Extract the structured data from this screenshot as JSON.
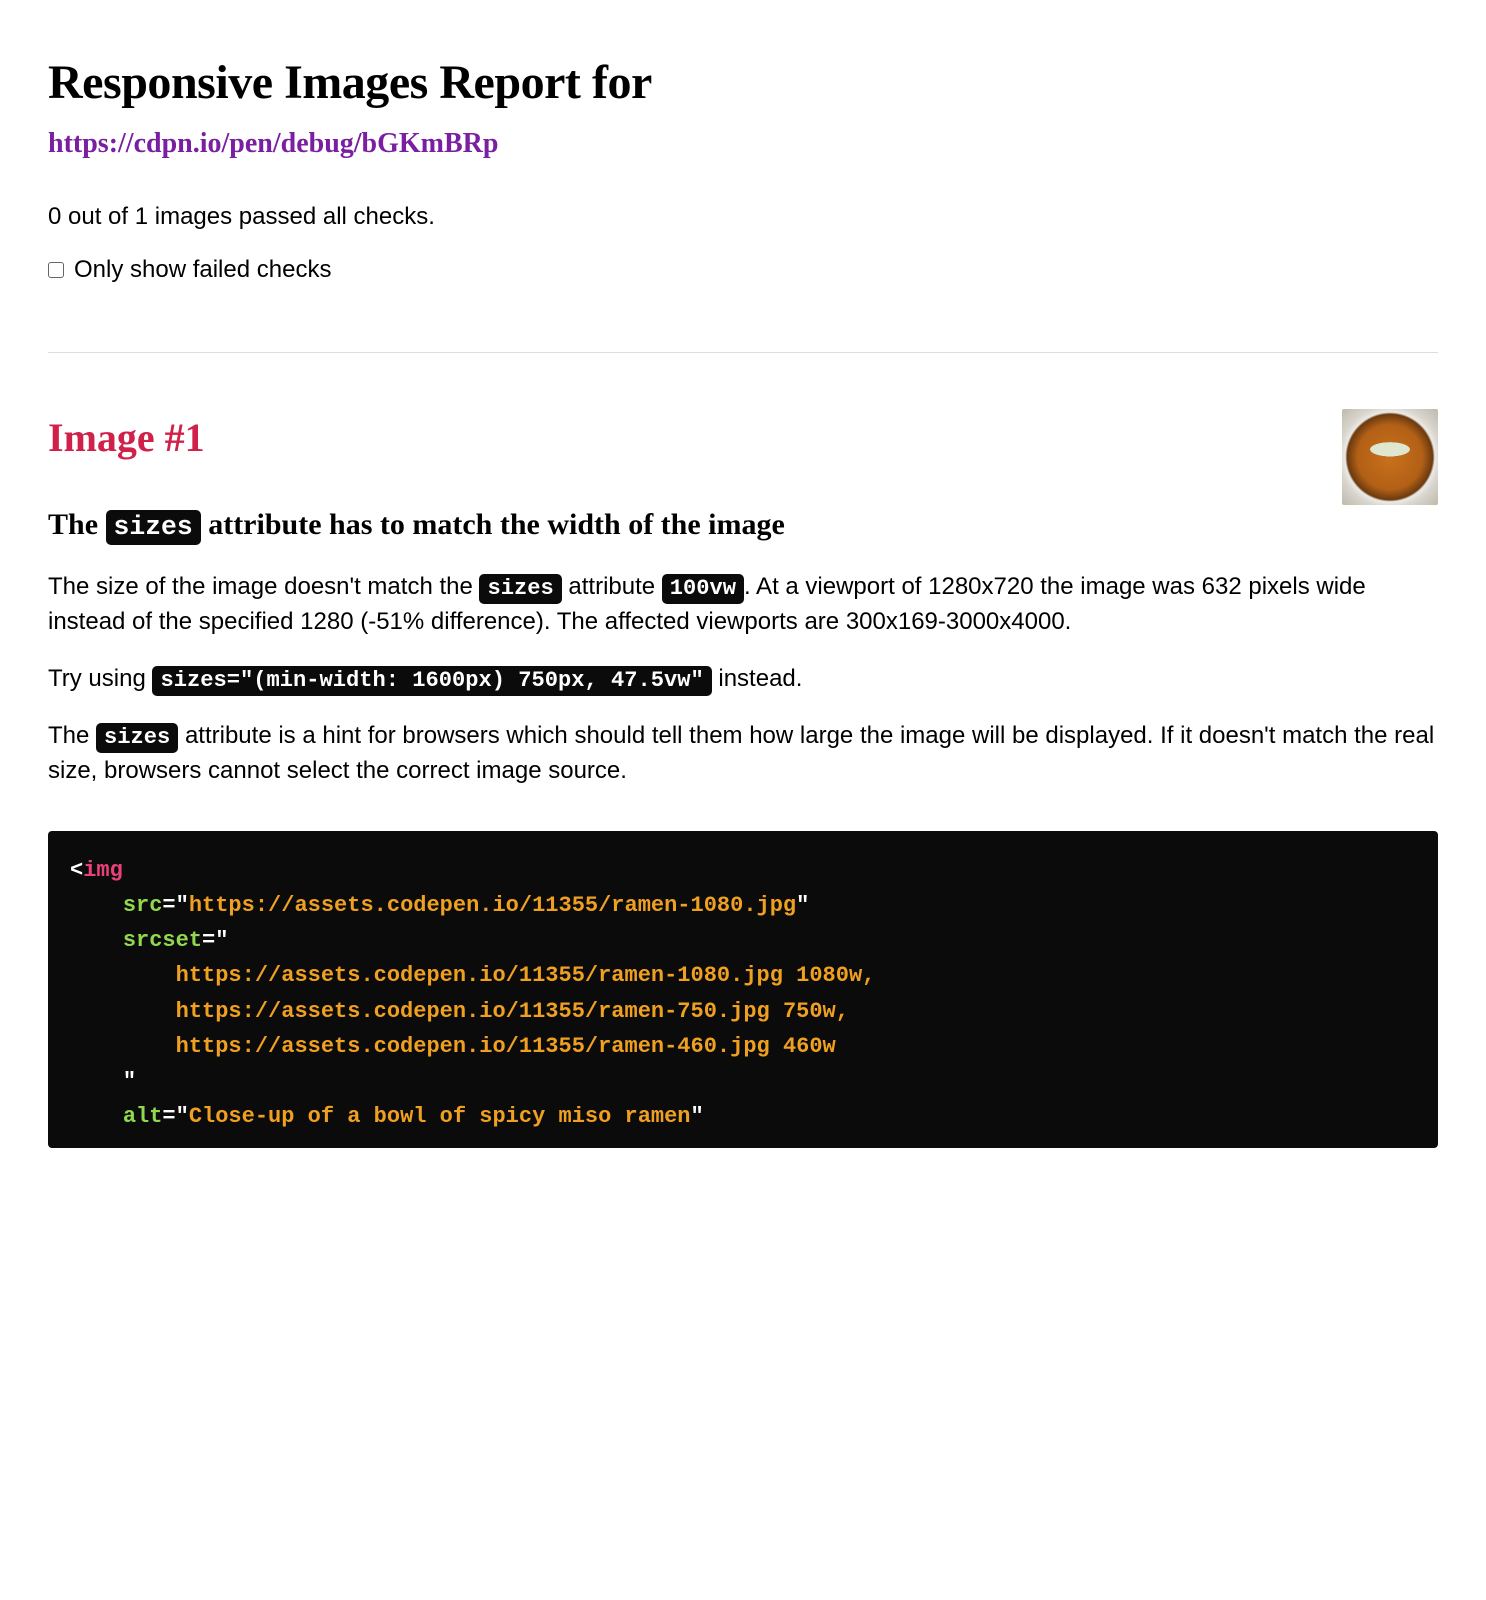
{
  "title": "Responsive Images Report for",
  "url": "https://cdpn.io/pen/debug/bGKmBRp",
  "summary": "0 out of 1 images passed all checks.",
  "filter_label": "Only show failed checks",
  "filter_checked": false,
  "image": {
    "heading": "Image #1",
    "check_heading": {
      "pre": "The ",
      "code": "sizes",
      "post": " attribute has to match the width of the image"
    },
    "p1": {
      "pre": "The size of the image doesn't match the ",
      "code1": "sizes",
      "mid1": " attribute ",
      "code2": "100vw",
      "post": ". At a viewport of 1280x720 the image was 632 pixels wide instead of the specified 1280 (-51% difference). The affected viewports are 300x169-3000x4000."
    },
    "p2": {
      "pre": "Try using ",
      "code": "sizes=\"(min-width: 1600px) 750px, 47.5vw\"",
      "post": " instead."
    },
    "p3": {
      "pre": "The ",
      "code": "sizes",
      "post": " attribute is a hint for browsers which should tell them how large the image will be displayed. If it doesn't match the real size, browsers cannot select the correct image source."
    },
    "code": {
      "tag": "img",
      "src_attr": "src",
      "src_val": "https://assets.codepen.io/11355/ramen-1080.jpg",
      "srcset_attr": "srcset",
      "srcset_lines": [
        {
          "url": "https://assets.codepen.io/11355/ramen-1080.jpg",
          "w": "1080w",
          "trail": ","
        },
        {
          "url": "https://assets.codepen.io/11355/ramen-750.jpg",
          "w": "750w",
          "trail": ","
        },
        {
          "url": "https://assets.codepen.io/11355/ramen-460.jpg",
          "w": "460w",
          "trail": ""
        }
      ],
      "alt_attr": "alt",
      "alt_val": "Close-up of a bowl of spicy miso ramen"
    }
  }
}
